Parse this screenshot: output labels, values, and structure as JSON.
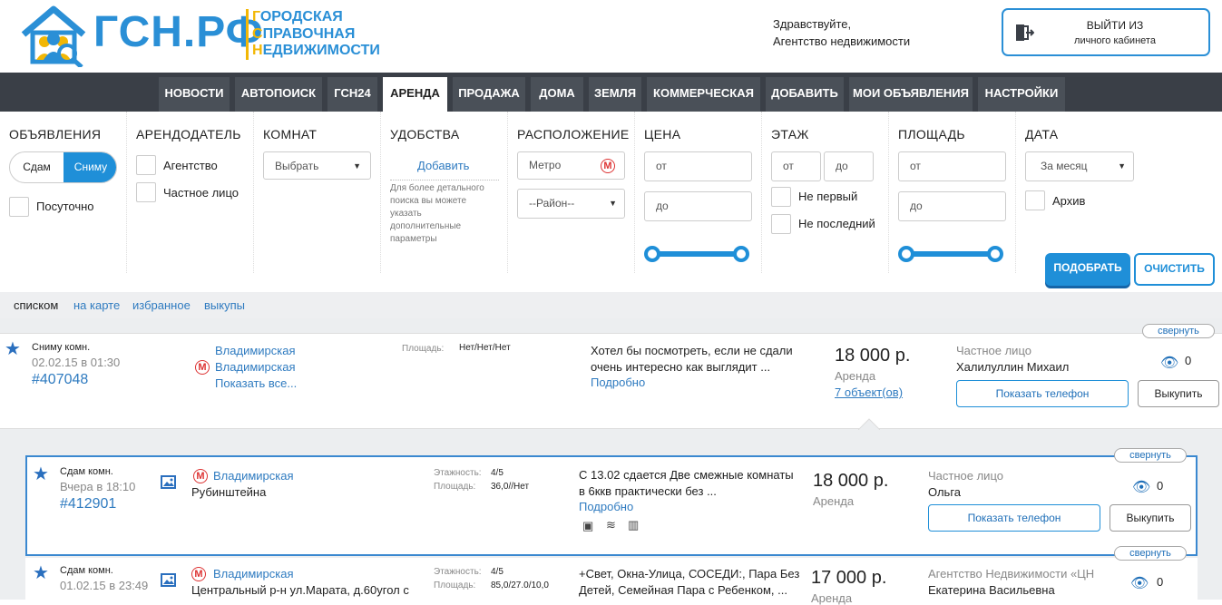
{
  "header": {
    "logo_text": "ГСН.РФ",
    "logo_sub": [
      "ГОРОДСКАЯ",
      "СПРАВОЧНАЯ",
      "НЕДВИЖИМОСТИ"
    ],
    "greeting_line1": "Здравствуйте,",
    "greeting_line2": "Агентство недвижимости",
    "logout_line1": "ВЫЙТИ ИЗ",
    "logout_line2": "личного кабинета"
  },
  "nav": {
    "items": [
      {
        "label": "НОВОСТИ",
        "active": false
      },
      {
        "label": "АВТОПОИСК",
        "active": false
      },
      {
        "label": "ГСН24",
        "active": false
      },
      {
        "label": "АРЕНДА",
        "active": true
      },
      {
        "label": "ПРОДАЖА",
        "active": false
      },
      {
        "label": "ДОМА",
        "active": false
      },
      {
        "label": "ЗЕМЛЯ",
        "active": false
      },
      {
        "label": "КОММЕРЧЕСКАЯ",
        "active": false
      },
      {
        "label": "ДОБАВИТЬ",
        "active": false
      },
      {
        "label": "МОИ ОБЪЯВЛЕНИЯ",
        "active": false
      },
      {
        "label": "НАСТРОЙКИ",
        "active": false
      }
    ]
  },
  "filters": {
    "ads": {
      "title": "ОБЪЯВЛЕНИЯ",
      "opt_a": "Сдам",
      "opt_b": "Сниму",
      "daily": "Посуточно"
    },
    "landlord": {
      "title": "АРЕНДОДАТЕЛЬ",
      "agency": "Агентство",
      "private": "Частное лицо"
    },
    "rooms": {
      "title": "КОМНАТ",
      "select": "Выбрать"
    },
    "amenities": {
      "title": "УДОБСТВА",
      "add": "Добавить",
      "hint": [
        "Для более детального",
        "поиска вы можете",
        "указать",
        "дополнительные",
        "параметры"
      ]
    },
    "location": {
      "title": "РАСПОЛОЖЕНИЕ",
      "metro": "Метро",
      "district": "--Район--"
    },
    "price": {
      "title": "ЦЕНА",
      "from": "от",
      "to": "до"
    },
    "floor": {
      "title": "ЭТАЖ",
      "from": "от",
      "to": "до",
      "not_first": "Не первый",
      "not_last": "Не последний"
    },
    "area": {
      "title": "ПЛОЩАДЬ",
      "from": "от",
      "to": "до"
    },
    "date": {
      "title": "ДАТА",
      "select": "За месяц",
      "archive": "Архив"
    },
    "pick": "ПОДОБРАТЬ",
    "clear": "ОЧИСТИТЬ"
  },
  "view": {
    "list": "списком",
    "map": "на карте",
    "fav": "избранное",
    "buyouts": "выкупы"
  },
  "listing1": {
    "type": "Сниму комн.",
    "date": "02.02.15 в 01:30",
    "id": "#407048",
    "metro1": "Владимирская",
    "metro2": "Владимирская",
    "show_all": "Показать все...",
    "area_label": "Площадь:",
    "area_value": "Нет/Нет/Нет",
    "desc1": "Хотел бы посмотреть, если не сдали",
    "desc2": "очень интересно как выглядит ...",
    "more": "Подробно",
    "price": "18 000 р.",
    "price_type": "Аренда",
    "objects": "7 объект(ов)",
    "owner_type": "Частное лицо",
    "owner_name": "Халилуллин Михаил",
    "views": "0",
    "show_phone": "Показать телефон",
    "buyout": "Выкупить",
    "collapse": "свернуть"
  },
  "listing2": {
    "type": "Сдам комн.",
    "date": "Вчера в 18:10",
    "id": "#412901",
    "metro": "Владимирская",
    "street": "Рубинштейна",
    "floors_label": "Этажность:",
    "floors_value": "4/5",
    "area_label": "Площадь:",
    "area_value": "36,0//Нет",
    "desc1": "С 13.02 сдается Две смежные комнаты",
    "desc2": "в 6ккв практически без ...",
    "more": "Подробно",
    "price": "18 000 р.",
    "price_type": "Аренда",
    "owner_type": "Частное лицо",
    "owner_name": "Ольга",
    "views": "0",
    "show_phone": "Показать телефон",
    "buyout": "Выкупить",
    "collapse": "свернуть"
  },
  "listing3": {
    "type": "Сдам комн.",
    "date": "01.02.15 в 23:49",
    "metro": "Владимирская",
    "street": "Центральный р-н ул.Марата, д.60угол с",
    "floors_label": "Этажность:",
    "floors_value": "4/5",
    "area_label": "Площадь:",
    "area_value": "85,0/27.0/10,0",
    "desc1": "+Свет, Окна-Улица, СОСЕДИ:, Пара Без",
    "desc2": "Детей, Семейная Пара с Ребенком, ...",
    "price": "17 000 р.",
    "price_type": "Аренда",
    "owner_type": "Агентство Недвижимости «ЦН",
    "owner_name": "Екатерина Васильевна",
    "views": "0",
    "collapse": "свернуть"
  },
  "colors": {
    "accent": "#1f8fd8",
    "nav_bg": "#3a3f47",
    "logo_yellow": "#f2b705"
  }
}
